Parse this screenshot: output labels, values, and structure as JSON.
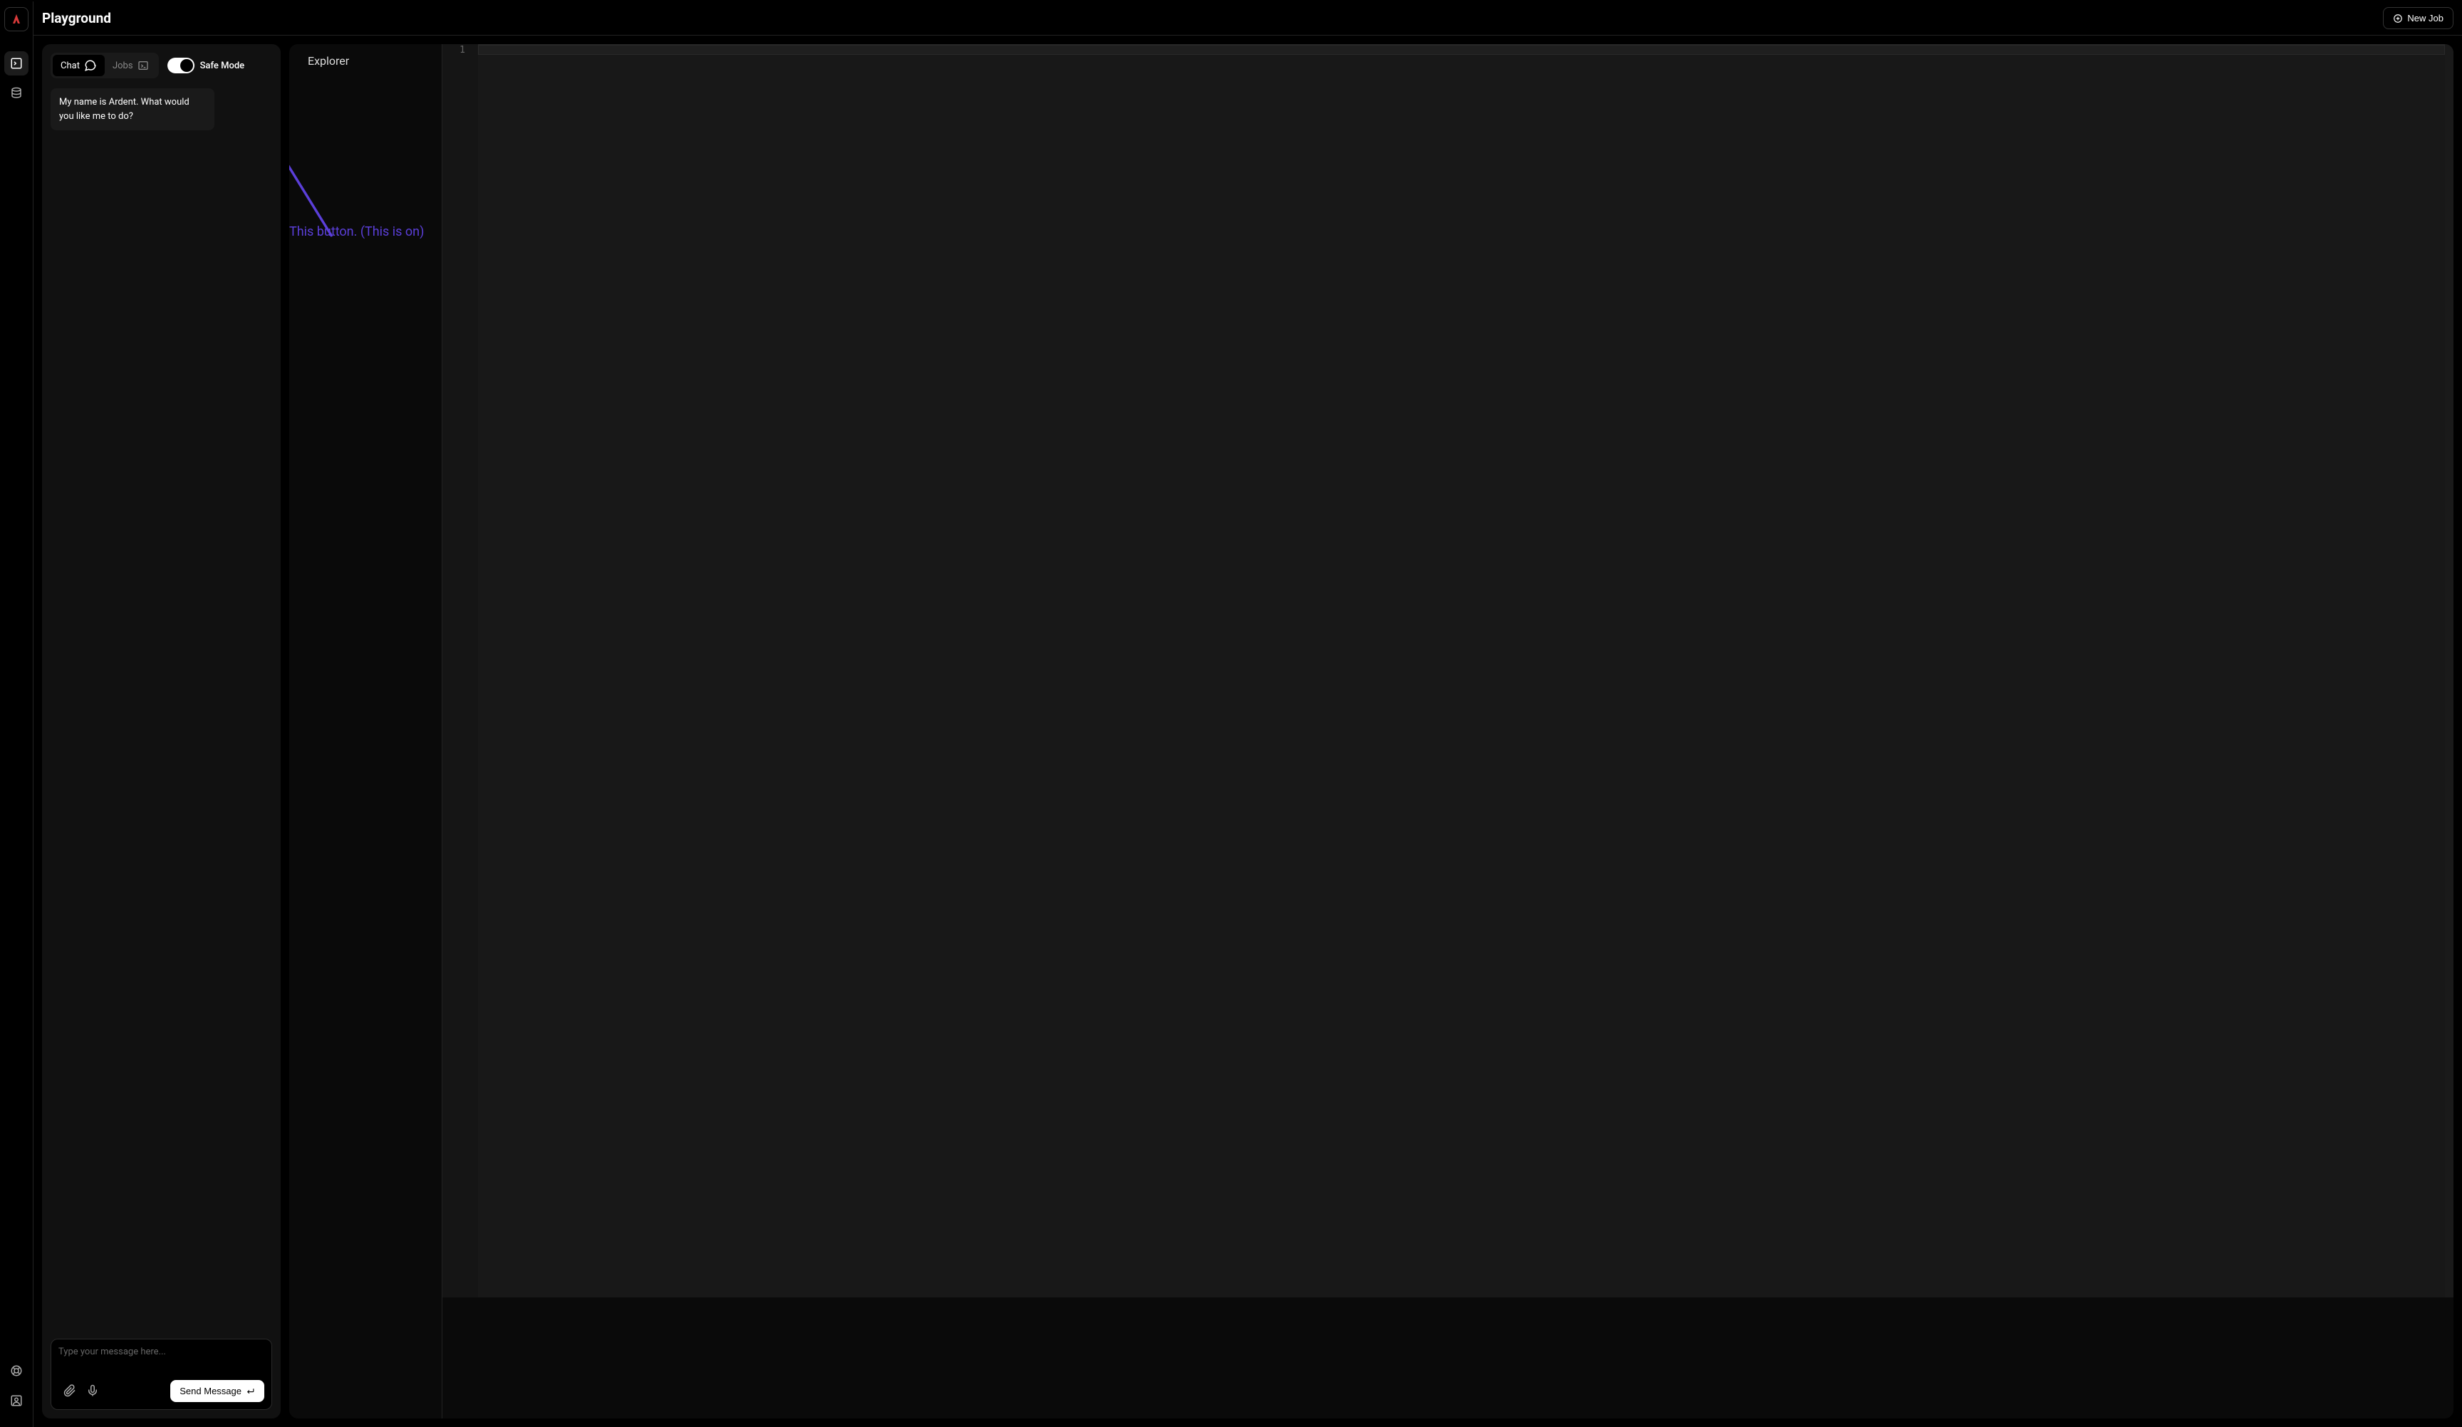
{
  "header": {
    "title": "Playground",
    "new_job_label": "New Job"
  },
  "sidebar": {
    "logo": "ardent-logo",
    "items": [
      "terminal-icon",
      "database-icon"
    ],
    "bottom_items": [
      "help-icon",
      "account-icon"
    ]
  },
  "chat": {
    "tabs": {
      "chat_label": "Chat",
      "jobs_label": "Jobs"
    },
    "safe_mode_label": "Safe Mode",
    "message": "My name is Ardent. What would you like me to do?",
    "input_placeholder": "Type your message here...",
    "send_label": "Send Message"
  },
  "explorer": {
    "title": "Explorer"
  },
  "editor": {
    "line_number": "1"
  },
  "annotation": {
    "text": "This button. (This is on)"
  }
}
